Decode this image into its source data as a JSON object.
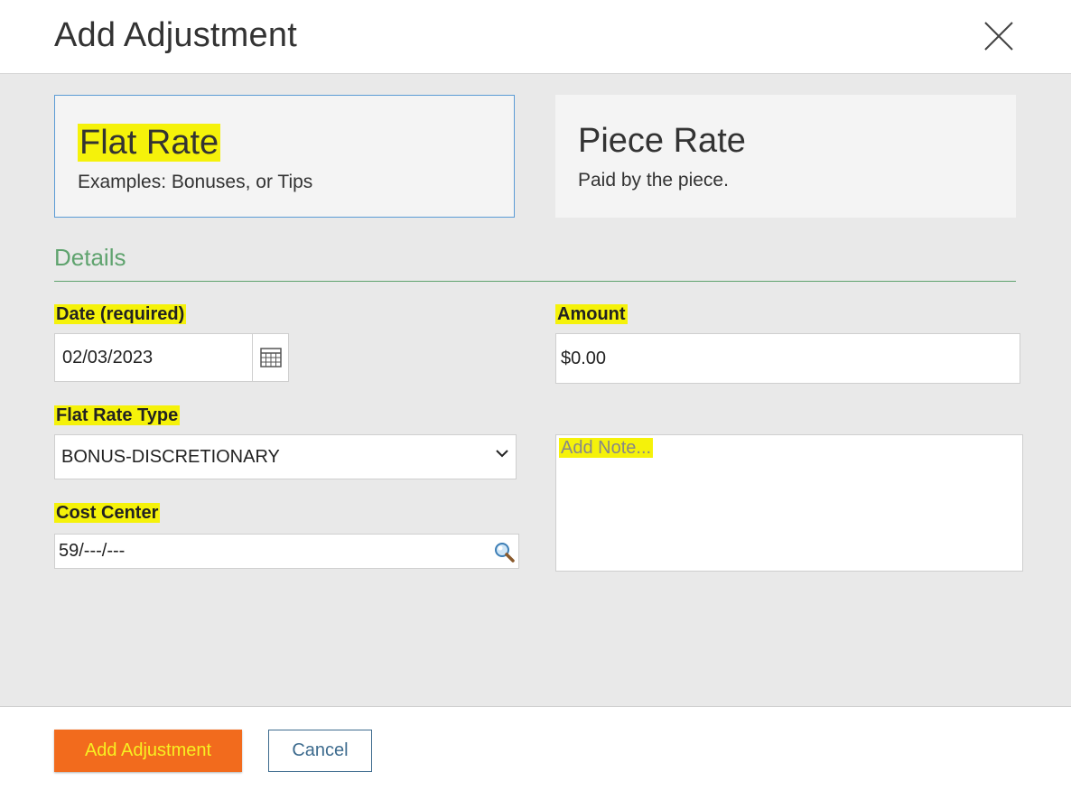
{
  "dialog": {
    "title": "Add Adjustment"
  },
  "cards": {
    "flat": {
      "title": "Flat Rate",
      "subtitle": "Examples: Bonuses, or Tips",
      "selected": true
    },
    "piece": {
      "title": "Piece Rate",
      "subtitle": "Paid by the piece.",
      "selected": false
    }
  },
  "details": {
    "section_title": "Details",
    "date_label": "Date (required)",
    "date_value": "02/03/2023",
    "amount_label": "Amount",
    "amount_value": "$0.00",
    "flat_rate_type_label": "Flat Rate Type",
    "flat_rate_type_value": "BONUS-DISCRETIONARY",
    "cost_center_label": "Cost Center",
    "cost_center_value": "59/---/---",
    "note_placeholder": "Add Note..."
  },
  "footer": {
    "primary_label": "Add Adjustment",
    "cancel_label": "Cancel"
  },
  "colors": {
    "accent_orange": "#f26b1d",
    "highlight_yellow": "#f5f20a",
    "section_green": "#5fa36e",
    "selected_border": "#5b9bd5"
  }
}
